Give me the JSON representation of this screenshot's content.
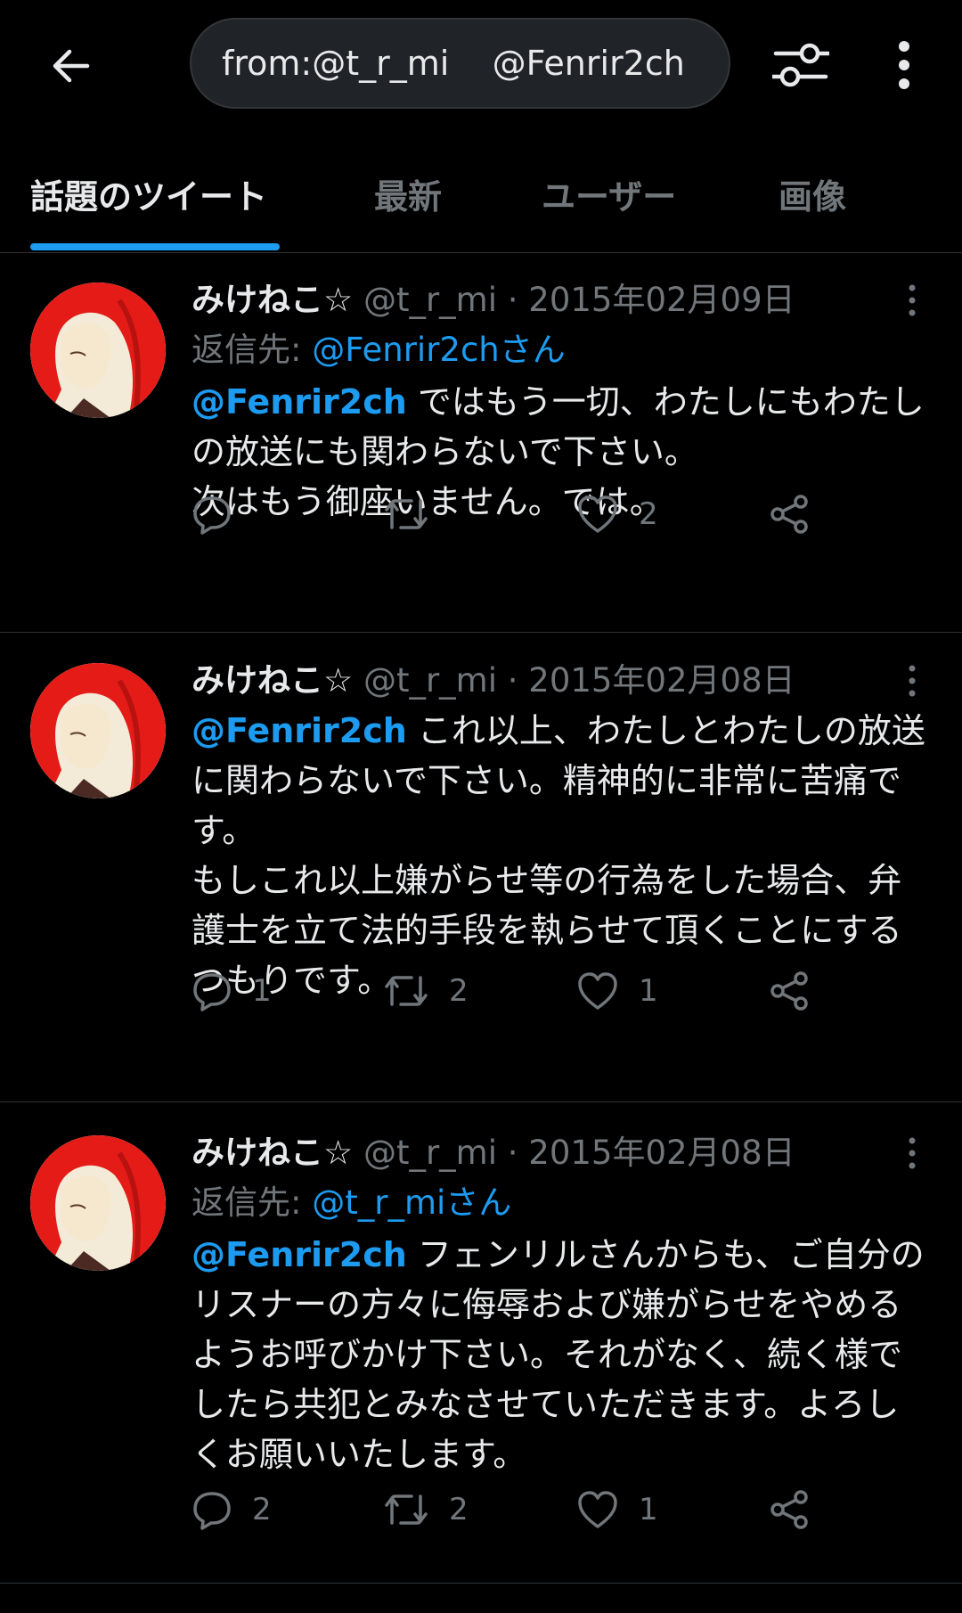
{
  "header": {
    "back_icon": "arrow-left-icon",
    "search_query": "from:@t_r_mi    @Fenrir2ch",
    "filter_icon": "sliders-icon",
    "more_icon": "more-vertical-icon"
  },
  "tabs": [
    {
      "label": "話題のツイート",
      "active": true
    },
    {
      "label": "最新",
      "active": false
    },
    {
      "label": "ユーザー",
      "active": false
    },
    {
      "label": "画像",
      "active": false
    }
  ],
  "tweets": [
    {
      "name": "みけねこ☆",
      "handle": "@t_r_mi",
      "separator": "·",
      "date": "2015年02月09日",
      "reply_prefix": "返信先:",
      "reply_to": "@Fenrir2chさん",
      "mention": "@Fenrir2ch",
      "text": " ではもう一切、わたしにもわたしの放送にも関わらないで下さい。\n次はもう御座いません。では。",
      "replies": "",
      "retweets": "",
      "likes": "2"
    },
    {
      "name": "みけねこ☆",
      "handle": "@t_r_mi",
      "separator": "·",
      "date": "2015年02月08日",
      "reply_prefix": "",
      "reply_to": "",
      "mention": "@Fenrir2ch",
      "text": " これ以上、わたしとわたしの放送に関わらないで下さい。精神的に非常に苦痛です。\nもしこれ以上嫌がらせ等の行為をした場合、弁護士を立て法的手段を執らせて頂くことにするつもりです。",
      "replies": "1",
      "retweets": "2",
      "likes": "1"
    },
    {
      "name": "みけねこ☆",
      "handle": "@t_r_mi",
      "separator": "·",
      "date": "2015年02月08日",
      "reply_prefix": "返信先:",
      "reply_to": "@t_r_miさん",
      "mention": "@Fenrir2ch",
      "text": " フェンリルさんからも、ご自分のリスナーの方々に侮辱および嫌がらせをやめるようお呼びかけ下さい。それがなく、続く様でしたら共犯とみなさせていただきます。よろしくお願いいたします。",
      "replies": "2",
      "retweets": "2",
      "likes": "1"
    }
  ],
  "colors": {
    "background": "#000000",
    "accent": "#1d9bf0",
    "muted": "#71767b",
    "avatar_hair": "#e41b17"
  }
}
